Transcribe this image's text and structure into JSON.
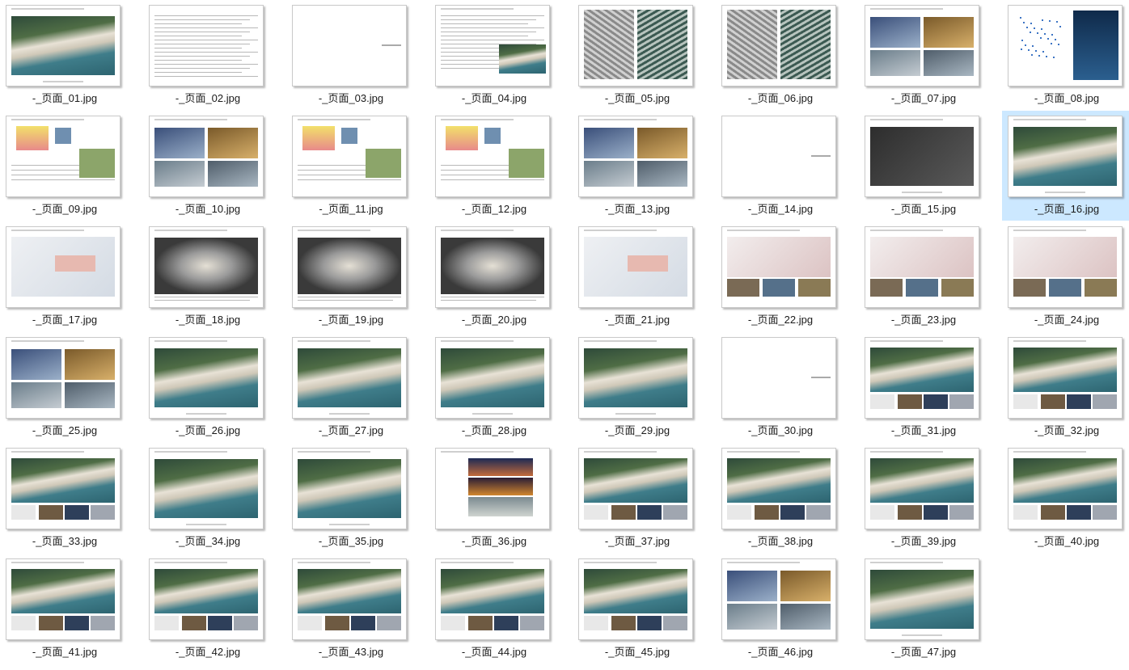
{
  "files": [
    {
      "name": "-_页面_01.jpg",
      "thumb": "render"
    },
    {
      "name": "-_页面_02.jpg",
      "thumb": "toc"
    },
    {
      "name": "-_页面_03.jpg",
      "thumb": "title"
    },
    {
      "name": "-_页面_04.jpg",
      "thumb": "text-image"
    },
    {
      "name": "-_页面_05.jpg",
      "thumb": "texture"
    },
    {
      "name": "-_页面_06.jpg",
      "thumb": "texture"
    },
    {
      "name": "-_页面_07.jpg",
      "thumb": "photos"
    },
    {
      "name": "-_页面_08.jpg",
      "thumb": "diagram-photo"
    },
    {
      "name": "-_页面_09.jpg",
      "thumb": "diagram"
    },
    {
      "name": "-_页面_10.jpg",
      "thumb": "photos"
    },
    {
      "name": "-_页面_11.jpg",
      "thumb": "diagram"
    },
    {
      "name": "-_页面_12.jpg",
      "thumb": "diagram"
    },
    {
      "name": "-_页面_13.jpg",
      "thumb": "photos"
    },
    {
      "name": "-_页面_14.jpg",
      "thumb": "title"
    },
    {
      "name": "-_页面_15.jpg",
      "thumb": "dark-plan"
    },
    {
      "name": "-_页面_16.jpg",
      "thumb": "render"
    },
    {
      "name": "-_页面_17.jpg",
      "thumb": "plan"
    },
    {
      "name": "-_页面_18.jpg",
      "thumb": "dark-model"
    },
    {
      "name": "-_页面_19.jpg",
      "thumb": "dark-model"
    },
    {
      "name": "-_页面_20.jpg",
      "thumb": "dark-model"
    },
    {
      "name": "-_页面_21.jpg",
      "thumb": "plan"
    },
    {
      "name": "-_页面_22.jpg",
      "thumb": "plan-photos"
    },
    {
      "name": "-_页面_23.jpg",
      "thumb": "plan-photos"
    },
    {
      "name": "-_页面_24.jpg",
      "thumb": "plan-photos"
    },
    {
      "name": "-_页面_25.jpg",
      "thumb": "photos"
    },
    {
      "name": "-_页面_26.jpg",
      "thumb": "render"
    },
    {
      "name": "-_页面_27.jpg",
      "thumb": "render"
    },
    {
      "name": "-_页面_28.jpg",
      "thumb": "render"
    },
    {
      "name": "-_页面_29.jpg",
      "thumb": "render"
    },
    {
      "name": "-_页面_30.jpg",
      "thumb": "title"
    },
    {
      "name": "-_页面_31.jpg",
      "thumb": "render-photos"
    },
    {
      "name": "-_页面_32.jpg",
      "thumb": "render-photos"
    },
    {
      "name": "-_页面_33.jpg",
      "thumb": "render-photos"
    },
    {
      "name": "-_页面_34.jpg",
      "thumb": "render"
    },
    {
      "name": "-_页面_35.jpg",
      "thumb": "render"
    },
    {
      "name": "-_页面_36.jpg",
      "thumb": "night-strips"
    },
    {
      "name": "-_页面_37.jpg",
      "thumb": "render-photos"
    },
    {
      "name": "-_页面_38.jpg",
      "thumb": "render-photos"
    },
    {
      "name": "-_页面_39.jpg",
      "thumb": "render-photos"
    },
    {
      "name": "-_页面_40.jpg",
      "thumb": "render-photos"
    },
    {
      "name": "-_页面_41.jpg",
      "thumb": "render-photos"
    },
    {
      "name": "-_页面_42.jpg",
      "thumb": "render-photos"
    },
    {
      "name": "-_页面_43.jpg",
      "thumb": "render-photos"
    },
    {
      "name": "-_页面_44.jpg",
      "thumb": "render-photos"
    },
    {
      "name": "-_页面_45.jpg",
      "thumb": "render-photos"
    },
    {
      "name": "-_页面_46.jpg",
      "thumb": "photos"
    },
    {
      "name": "-_页面_47.jpg",
      "thumb": "render"
    }
  ],
  "selected_file": "-_页面_16.jpg",
  "colors": {
    "selection": "#cce8ff",
    "sea": "#3f7d8a",
    "land": "#4e6a32",
    "building": "#eae6dd",
    "dark_bg": "#3a3a3a"
  }
}
